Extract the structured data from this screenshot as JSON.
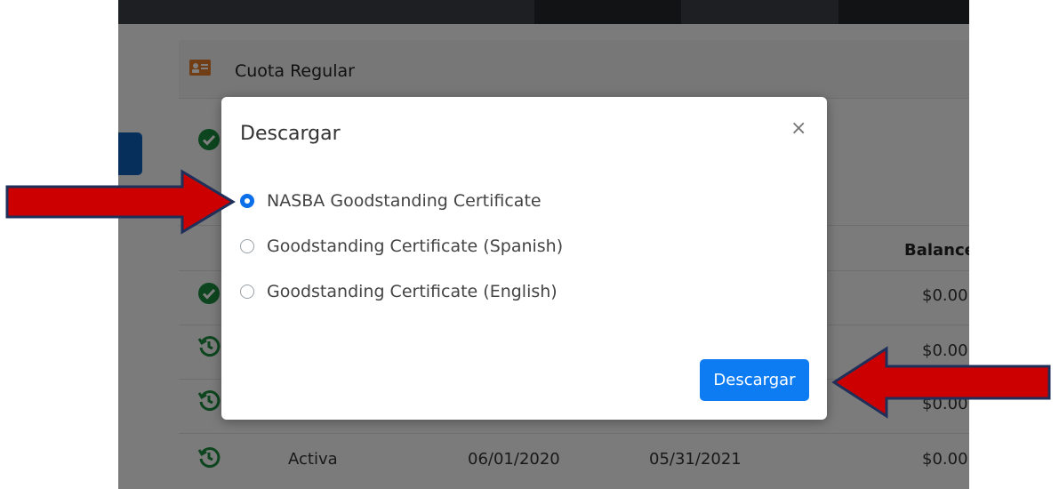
{
  "section": {
    "title": "Cuota Regular"
  },
  "table": {
    "balance_header": "Balance",
    "balances": [
      "$0.00",
      "$0.00",
      "$0.00",
      "$0.00"
    ],
    "last_row": {
      "status": "Activa",
      "start": "06/01/2020",
      "end": "05/31/2021",
      "balance": "$0.00"
    }
  },
  "modal": {
    "title": "Descargar",
    "close": "×",
    "options": [
      {
        "label": "NASBA Goodstanding Certificate",
        "selected": true
      },
      {
        "label": "Goodstanding Certificate (Spanish)",
        "selected": false
      },
      {
        "label": "Goodstanding Certificate (English)",
        "selected": false
      }
    ],
    "download_label": "Descargar"
  },
  "colors": {
    "primary": "#0d7cf2",
    "success": "#1a8a3c",
    "arrow_fill": "#cc0000",
    "arrow_stroke": "#1f2f5a"
  },
  "icons": [
    "id-card-icon",
    "check-circle-icon",
    "history-icon",
    "close-icon",
    "arrow-annotation-icon"
  ]
}
